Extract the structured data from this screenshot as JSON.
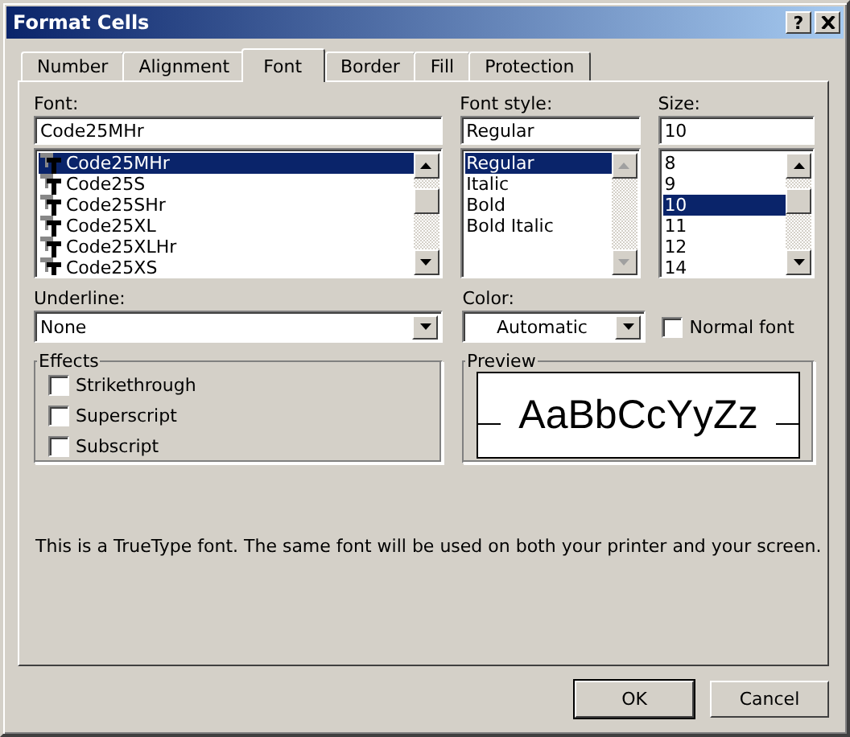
{
  "window": {
    "title": "Format Cells",
    "help": "?"
  },
  "tabs": [
    {
      "label": "Number",
      "selected": false
    },
    {
      "label": "Alignment",
      "selected": false
    },
    {
      "label": "Font",
      "selected": true
    },
    {
      "label": "Border",
      "selected": false
    },
    {
      "label": "Fill",
      "selected": false
    },
    {
      "label": "Protection",
      "selected": false
    }
  ],
  "font": {
    "label": "Font:",
    "value": "Code25MHr",
    "scrollbar": {
      "disabled": false
    },
    "items": [
      {
        "text": "Code25MHr",
        "selected": true
      },
      {
        "text": "Code25S",
        "selected": false
      },
      {
        "text": "Code25SHr",
        "selected": false
      },
      {
        "text": "Code25XL",
        "selected": false
      },
      {
        "text": "Code25XLHr",
        "selected": false
      },
      {
        "text": "Code25XS",
        "selected": false
      }
    ]
  },
  "font_style": {
    "label": "Font style:",
    "value": "Regular",
    "scrollbar": {
      "disabled": true
    },
    "items": [
      {
        "text": "Regular",
        "selected": true
      },
      {
        "text": "Italic",
        "selected": false
      },
      {
        "text": "Bold",
        "selected": false
      },
      {
        "text": "Bold Italic",
        "selected": false
      }
    ]
  },
  "size": {
    "label": "Size:",
    "value": "10",
    "scrollbar": {
      "disabled": false
    },
    "items": [
      {
        "text": "8",
        "selected": false
      },
      {
        "text": "9",
        "selected": false
      },
      {
        "text": "10",
        "selected": true
      },
      {
        "text": "11",
        "selected": false
      },
      {
        "text": "12",
        "selected": false
      },
      {
        "text": "14",
        "selected": false
      }
    ]
  },
  "underline": {
    "label": "Underline:",
    "value": "None"
  },
  "color": {
    "label": "Color:",
    "value": "Automatic"
  },
  "normal_font": {
    "label": "Normal font",
    "checked": false
  },
  "effects": {
    "title": "Effects",
    "options": [
      {
        "label": "Strikethrough",
        "checked": false
      },
      {
        "label": "Superscript",
        "checked": false
      },
      {
        "label": "Subscript",
        "checked": false
      }
    ]
  },
  "preview": {
    "title": "Preview",
    "sample": "AaBbCcYyZz"
  },
  "info": "This is a TrueType font.  The same font will be used on both your printer and your screen.",
  "buttons": [
    {
      "label": "OK",
      "default": true
    },
    {
      "label": "Cancel",
      "default": false
    }
  ]
}
